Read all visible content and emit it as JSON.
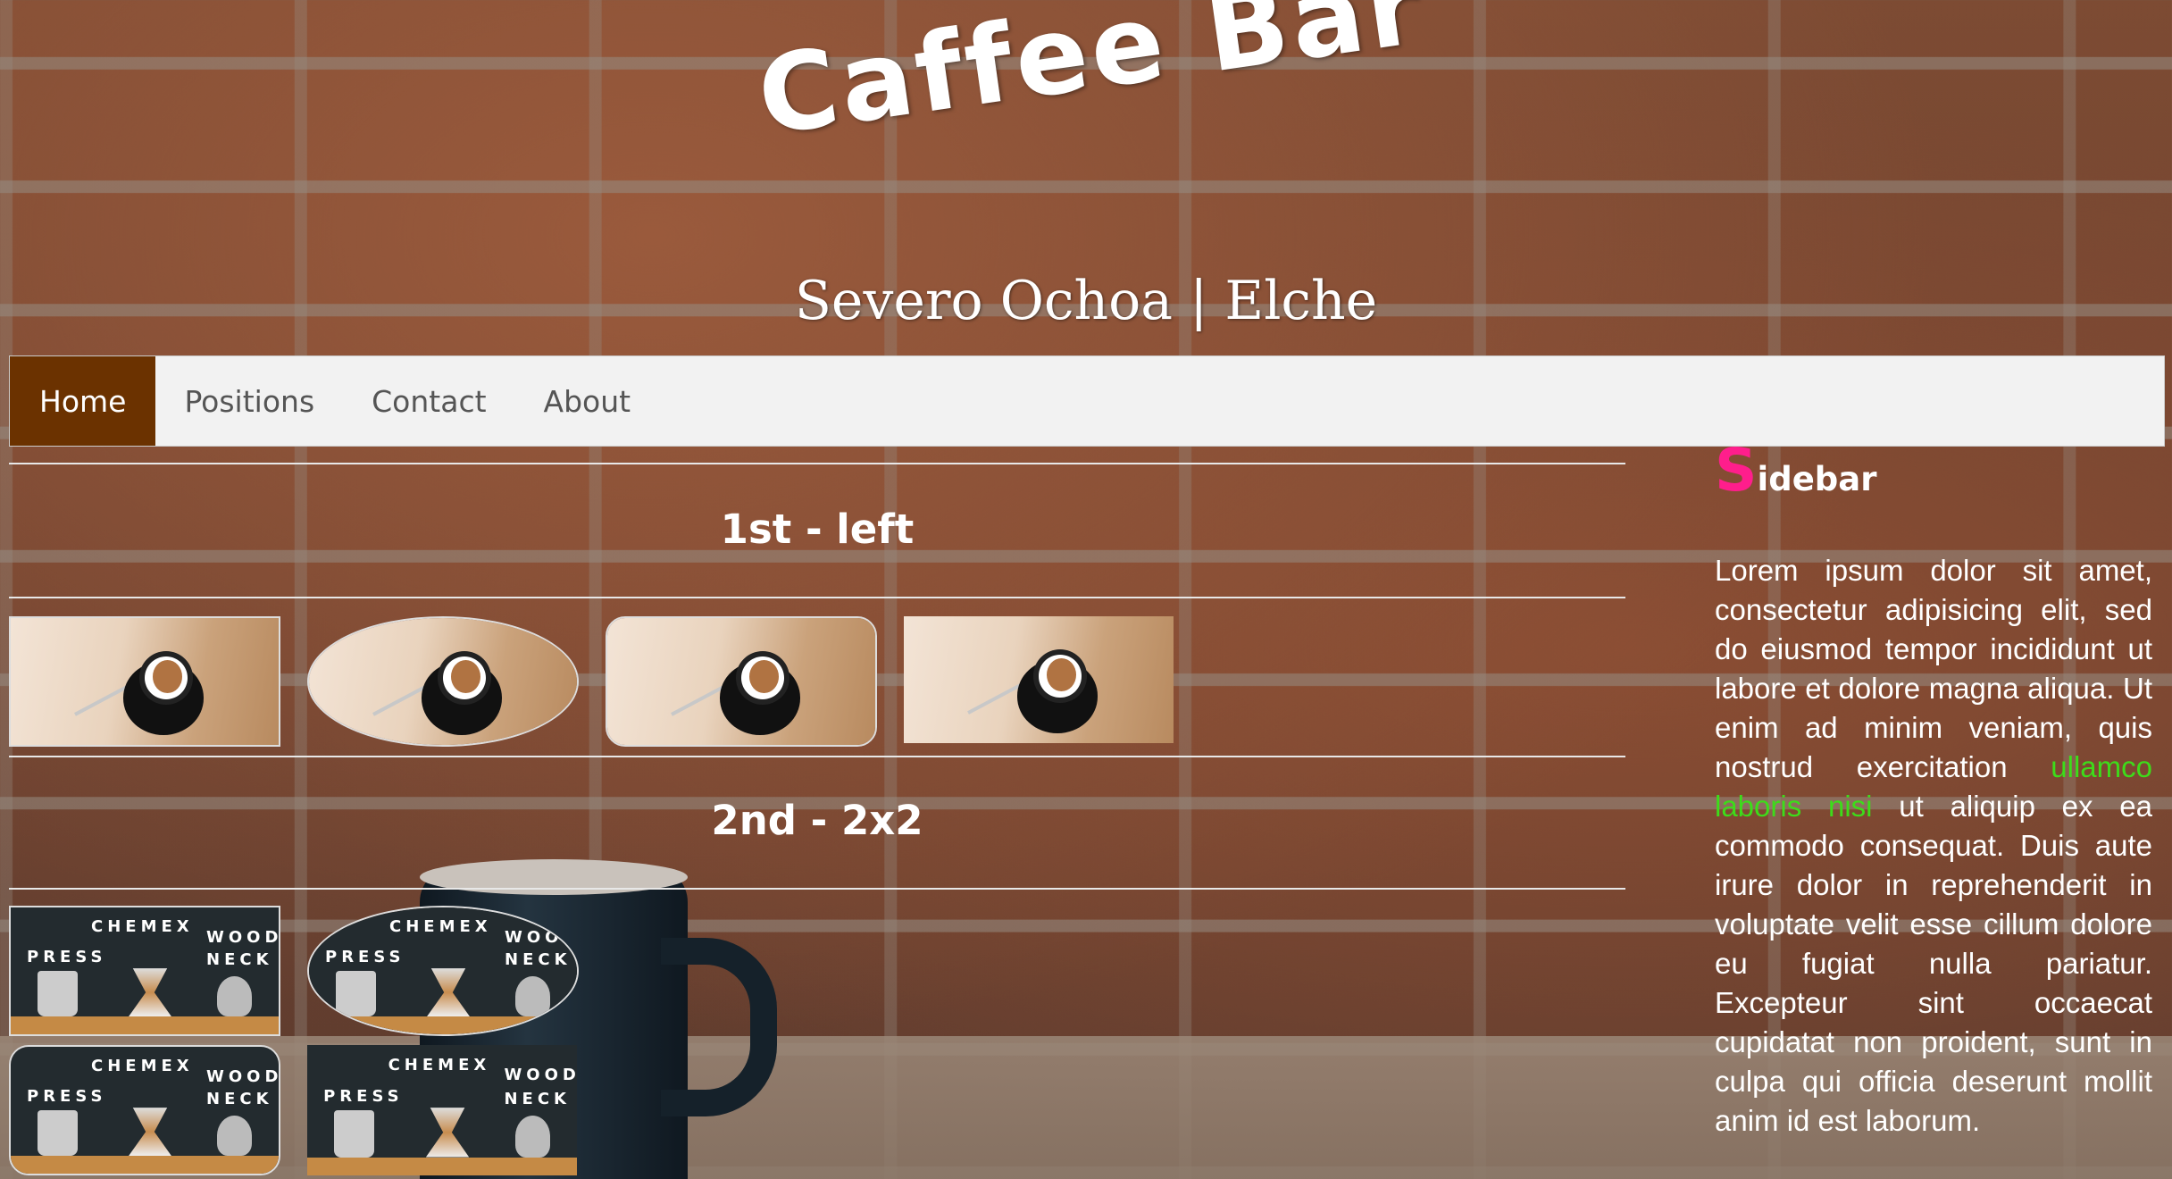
{
  "header": {
    "title": "Caffee Bar",
    "subtitle": "Severo Ochoa | Elche"
  },
  "nav": {
    "items": [
      {
        "label": "Home",
        "active": true
      },
      {
        "label": "Positions",
        "active": false
      },
      {
        "label": "Contact",
        "active": false
      },
      {
        "label": "About",
        "active": false
      }
    ],
    "active_color": "#6b3200"
  },
  "main": {
    "section1_title": "1st - left",
    "section2_title": "2nd - 2x2",
    "chemex_labels": {
      "press": "PRESS",
      "chemex": "CHEMEX",
      "wood": "WOOD",
      "neck": "NECK"
    }
  },
  "sidebar": {
    "title_first": "S",
    "title_rest": "idebar",
    "text_before": "Lorem ipsum dolor sit amet, consectetur adipisicing elit, sed do eiusmod tempor incididunt ut labore et dolore magna aliqua. Ut enim ad minim veniam, quis nostrud exercitation ",
    "text_highlight": "ullamco laboris nisi",
    "text_after": " ut aliquip ex ea commodo consequat. Duis aute irure dolor in reprehenderit in voluptate velit esse cillum dolore eu fugiat nulla pariatur. Excepteur sint occaecat cupidatat non proident, sunt in culpa qui officia deserunt mollit anim id est laborum.",
    "title_accent_color": "#ff1e8c",
    "highlight_color": "#3ddc1a"
  }
}
